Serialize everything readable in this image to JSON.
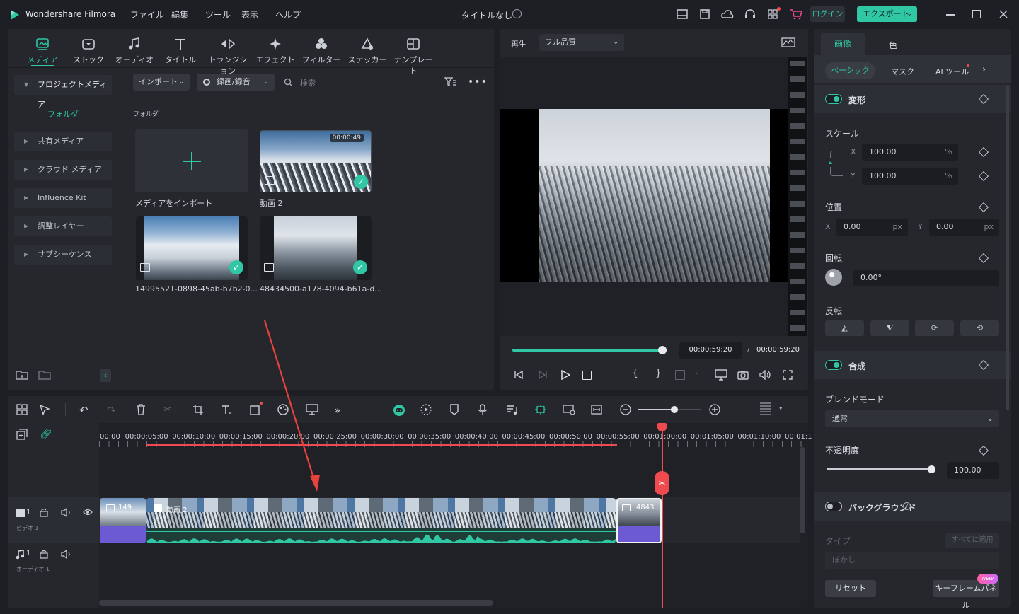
{
  "app": {
    "title": "Wondershare Filmora",
    "project_title": "タイトルなし"
  },
  "menu": [
    "ファイル",
    "編集",
    "ツール",
    "表示",
    "ヘルプ"
  ],
  "header_buttons": {
    "login": "ログイン",
    "export": "エクスポート"
  },
  "tool_tabs": [
    "メディア",
    "ストック",
    "オーディオ",
    "タイトル",
    "トランジション",
    "エフェクト",
    "フィルター",
    "ステッカー",
    "テンプレート"
  ],
  "sidebar": {
    "project_media": "プロジェクトメディア",
    "folder": "フォルダ",
    "items": [
      "共有メディア",
      "クラウド メディア",
      "Influence Kit",
      "調整レイヤー",
      "サブシーケンス"
    ]
  },
  "media_toolbar": {
    "import": "インポート",
    "record": "録画/録音",
    "search_placeholder": "検索"
  },
  "media": {
    "folder_label": "フォルダ",
    "import_tile_label": "メディアをインポート",
    "items": [
      {
        "name": "動画 2",
        "duration": "00:00:49"
      },
      {
        "name": "14995521-0898-45ab-b7b2-0..."
      },
      {
        "name": "48434500-a178-4094-b61a-d..."
      }
    ]
  },
  "player": {
    "play_label": "再生",
    "quality": "フル品質",
    "current_time": "00:00:59:20",
    "total_time": "00:00:59:20",
    "separator": "/",
    "progress": 1.0
  },
  "timeline": {
    "ticks": [
      "00:00",
      "00:00:05:00",
      "00:00:10:00",
      "00:00:15:00",
      "00:00:20:00",
      "00:00:25:00",
      "00:00:30:00",
      "00:00:35:00",
      "00:00:40:00",
      "00:00:45:00",
      "00:00:50:00",
      "00:00:55:00",
      "00:01:00:00",
      "00:01:05:00",
      "00:01:10:00",
      "00:01:1"
    ],
    "video_track": {
      "label": "ビデオ 1",
      "num": "1"
    },
    "audio_track": {
      "label": "オーディオ 1",
      "num": "1"
    },
    "clips": [
      {
        "name": "149"
      },
      {
        "name": "動画 2"
      },
      {
        "name": "4843..."
      }
    ],
    "zoom": 0.58
  },
  "props": {
    "tabs": [
      "画像",
      "色"
    ],
    "subtabs": [
      "ベーシック",
      "マスク",
      "AI ツール"
    ],
    "transform": {
      "label": "変形",
      "scale_label": "スケール",
      "x_axis": "X",
      "y_axis": "Y",
      "scale_x": "100.00",
      "scale_y": "100.00",
      "percent": "%"
    },
    "position": {
      "label": "位置",
      "x_axis": "X",
      "y_axis": "Y",
      "x": "0.00",
      "y": "0.00",
      "unit": "px"
    },
    "rotation": {
      "label": "回転",
      "value": "0.00°"
    },
    "flip": {
      "label": "反転"
    },
    "composite": {
      "label": "合成",
      "blend_label": "ブレンドモード",
      "blend_value": "通常",
      "opacity_label": "不透明度",
      "opacity_value": "100.00",
      "opacity_level": 1.0
    },
    "background": {
      "label": "バックグラウンド",
      "type_label": "タイプ",
      "apply_all": "すべてに適用",
      "type_value": "ぼかし"
    },
    "reset": "リセット",
    "keyframe": "キーフレームパネル",
    "new_badge": "NEW"
  },
  "colors": {
    "accent": "#2fc7a4",
    "playhead": "#ef4a4f",
    "clip_purple": "#6b5ad1"
  }
}
